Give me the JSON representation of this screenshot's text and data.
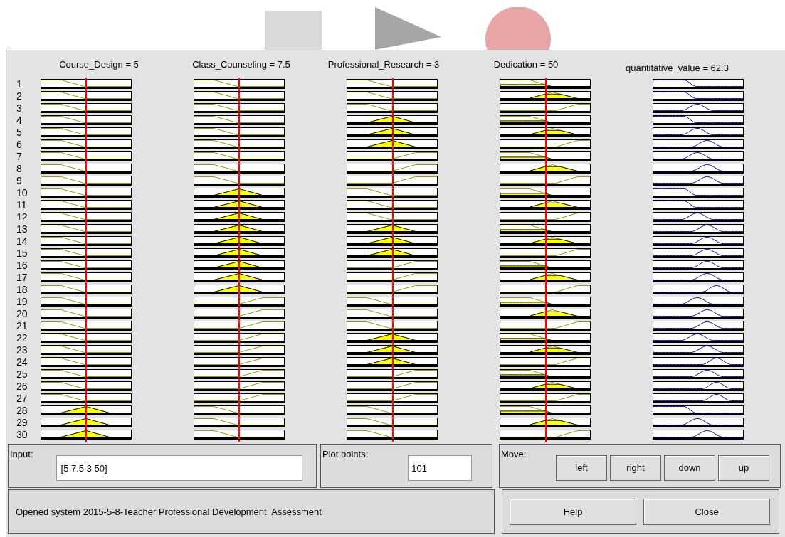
{
  "inputs": [
    {
      "label": "Course_Design = 5",
      "level": 0.49
    },
    {
      "label": "Class_Counseling = 7.5",
      "level": 0.49
    },
    {
      "label": "Professional_Research = 3",
      "level": 0.5
    },
    {
      "label": "Dedication = 50",
      "level": 0.5
    }
  ],
  "output": {
    "label": "quantitative_value = 62.3"
  },
  "rules": [
    {
      "number": "1",
      "plots": [
        {
          "kind": "low"
        },
        {
          "kind": "low"
        },
        {
          "kind": "low"
        },
        {
          "kind": "low"
        }
      ],
      "output_plot": {
        "kind": "low"
      }
    },
    {
      "number": "2",
      "plots": [
        {
          "kind": "low"
        },
        {
          "kind": "low"
        },
        {
          "kind": "low"
        },
        {
          "kind": "medium"
        }
      ],
      "output_plot": {
        "kind": "low"
      }
    },
    {
      "number": "3",
      "plots": [
        {
          "kind": "low"
        },
        {
          "kind": "low"
        },
        {
          "kind": "low"
        },
        {
          "kind": "high"
        }
      ],
      "output_plot": {
        "kind": "medium"
      }
    },
    {
      "number": "4",
      "plots": [
        {
          "kind": "low"
        },
        {
          "kind": "low"
        },
        {
          "kind": "medium"
        },
        {
          "kind": "low"
        }
      ],
      "output_plot": {
        "kind": "low"
      }
    },
    {
      "number": "5",
      "plots": [
        {
          "kind": "low"
        },
        {
          "kind": "low"
        },
        {
          "kind": "medium"
        },
        {
          "kind": "medium"
        }
      ],
      "output_plot": {
        "kind": "medium"
      }
    },
    {
      "number": "6",
      "plots": [
        {
          "kind": "low"
        },
        {
          "kind": "low"
        },
        {
          "kind": "medium"
        },
        {
          "kind": "high"
        }
      ],
      "output_plot": {
        "kind": "high"
      }
    },
    {
      "number": "7",
      "plots": [
        {
          "kind": "low"
        },
        {
          "kind": "low"
        },
        {
          "kind": "high"
        },
        {
          "kind": "low"
        }
      ],
      "output_plot": {
        "kind": "medium"
      }
    },
    {
      "number": "8",
      "plots": [
        {
          "kind": "low"
        },
        {
          "kind": "low"
        },
        {
          "kind": "high"
        },
        {
          "kind": "medium"
        }
      ],
      "output_plot": {
        "kind": "high"
      }
    },
    {
      "number": "9",
      "plots": [
        {
          "kind": "low"
        },
        {
          "kind": "low"
        },
        {
          "kind": "high"
        },
        {
          "kind": "high"
        }
      ],
      "output_plot": {
        "kind": "high"
      }
    },
    {
      "number": "10",
      "plots": [
        {
          "kind": "low"
        },
        {
          "kind": "medium"
        },
        {
          "kind": "low"
        },
        {
          "kind": "low"
        }
      ],
      "output_plot": {
        "kind": "low"
      }
    },
    {
      "number": "11",
      "plots": [
        {
          "kind": "low"
        },
        {
          "kind": "medium"
        },
        {
          "kind": "low"
        },
        {
          "kind": "medium"
        }
      ],
      "output_plot": {
        "kind": "low"
      }
    },
    {
      "number": "12",
      "plots": [
        {
          "kind": "low"
        },
        {
          "kind": "medium"
        },
        {
          "kind": "low"
        },
        {
          "kind": "high"
        }
      ],
      "output_plot": {
        "kind": "medium"
      }
    },
    {
      "number": "13",
      "plots": [
        {
          "kind": "low"
        },
        {
          "kind": "medium"
        },
        {
          "kind": "medium"
        },
        {
          "kind": "low"
        }
      ],
      "output_plot": {
        "kind": "high"
      }
    },
    {
      "number": "14",
      "plots": [
        {
          "kind": "low"
        },
        {
          "kind": "medium"
        },
        {
          "kind": "medium"
        },
        {
          "kind": "medium"
        }
      ],
      "output_plot": {
        "kind": "high"
      }
    },
    {
      "number": "15",
      "plots": [
        {
          "kind": "low"
        },
        {
          "kind": "medium"
        },
        {
          "kind": "medium"
        },
        {
          "kind": "high"
        }
      ],
      "output_plot": {
        "kind": "high"
      }
    },
    {
      "number": "16",
      "plots": [
        {
          "kind": "low"
        },
        {
          "kind": "medium"
        },
        {
          "kind": "high"
        },
        {
          "kind": "low"
        }
      ],
      "output_plot": {
        "kind": "high"
      }
    },
    {
      "number": "17",
      "plots": [
        {
          "kind": "low"
        },
        {
          "kind": "medium"
        },
        {
          "kind": "high"
        },
        {
          "kind": "medium"
        }
      ],
      "output_plot": {
        "kind": "high"
      }
    },
    {
      "number": "18",
      "plots": [
        {
          "kind": "low"
        },
        {
          "kind": "medium"
        },
        {
          "kind": "high"
        },
        {
          "kind": "high"
        }
      ],
      "output_plot": {
        "kind": "top"
      }
    },
    {
      "number": "19",
      "plots": [
        {
          "kind": "low"
        },
        {
          "kind": "high"
        },
        {
          "kind": "low"
        },
        {
          "kind": "low"
        }
      ],
      "output_plot": {
        "kind": "medium"
      }
    },
    {
      "number": "20",
      "plots": [
        {
          "kind": "low"
        },
        {
          "kind": "high"
        },
        {
          "kind": "low"
        },
        {
          "kind": "medium"
        }
      ],
      "output_plot": {
        "kind": "high"
      }
    },
    {
      "number": "21",
      "plots": [
        {
          "kind": "low"
        },
        {
          "kind": "high"
        },
        {
          "kind": "low"
        },
        {
          "kind": "high"
        }
      ],
      "output_plot": {
        "kind": "high"
      }
    },
    {
      "number": "22",
      "plots": [
        {
          "kind": "low"
        },
        {
          "kind": "high"
        },
        {
          "kind": "medium"
        },
        {
          "kind": "low"
        }
      ],
      "output_plot": {
        "kind": "medium"
      }
    },
    {
      "number": "23",
      "plots": [
        {
          "kind": "low"
        },
        {
          "kind": "high"
        },
        {
          "kind": "medium"
        },
        {
          "kind": "medium"
        }
      ],
      "output_plot": {
        "kind": "high"
      }
    },
    {
      "number": "24",
      "plots": [
        {
          "kind": "low"
        },
        {
          "kind": "high"
        },
        {
          "kind": "medium"
        },
        {
          "kind": "high"
        }
      ],
      "output_plot": {
        "kind": "top"
      }
    },
    {
      "number": "25",
      "plots": [
        {
          "kind": "low"
        },
        {
          "kind": "high"
        },
        {
          "kind": "high"
        },
        {
          "kind": "low"
        }
      ],
      "output_plot": {
        "kind": "high"
      }
    },
    {
      "number": "26",
      "plots": [
        {
          "kind": "low"
        },
        {
          "kind": "high"
        },
        {
          "kind": "high"
        },
        {
          "kind": "medium"
        }
      ],
      "output_plot": {
        "kind": "top"
      }
    },
    {
      "number": "27",
      "plots": [
        {
          "kind": "low"
        },
        {
          "kind": "high"
        },
        {
          "kind": "high"
        },
        {
          "kind": "high"
        }
      ],
      "output_plot": {
        "kind": "top"
      }
    },
    {
      "number": "28",
      "plots": [
        {
          "kind": "medium"
        },
        {
          "kind": "low"
        },
        {
          "kind": "low"
        },
        {
          "kind": "low"
        }
      ],
      "output_plot": {
        "kind": "low"
      }
    },
    {
      "number": "29",
      "plots": [
        {
          "kind": "medium"
        },
        {
          "kind": "low"
        },
        {
          "kind": "low"
        },
        {
          "kind": "medium"
        }
      ],
      "output_plot": {
        "kind": "medium"
      }
    },
    {
      "number": "30",
      "plots": [
        {
          "kind": "medium"
        },
        {
          "kind": "low"
        },
        {
          "kind": "low"
        },
        {
          "kind": "high"
        }
      ],
      "output_plot": {
        "kind": "high"
      }
    }
  ],
  "input_field": {
    "label": "Input:",
    "value": "[5 7.5 3 50]"
  },
  "plot_points": {
    "label": "Plot points:",
    "value": "101"
  },
  "move": {
    "label": "Move:",
    "buttons": [
      "left",
      "right",
      "down",
      "up"
    ]
  },
  "status": "Opened system 2015-5-8-Teacher Professional Development  Assessment",
  "buttons": [
    "Help",
    "Close"
  ]
}
